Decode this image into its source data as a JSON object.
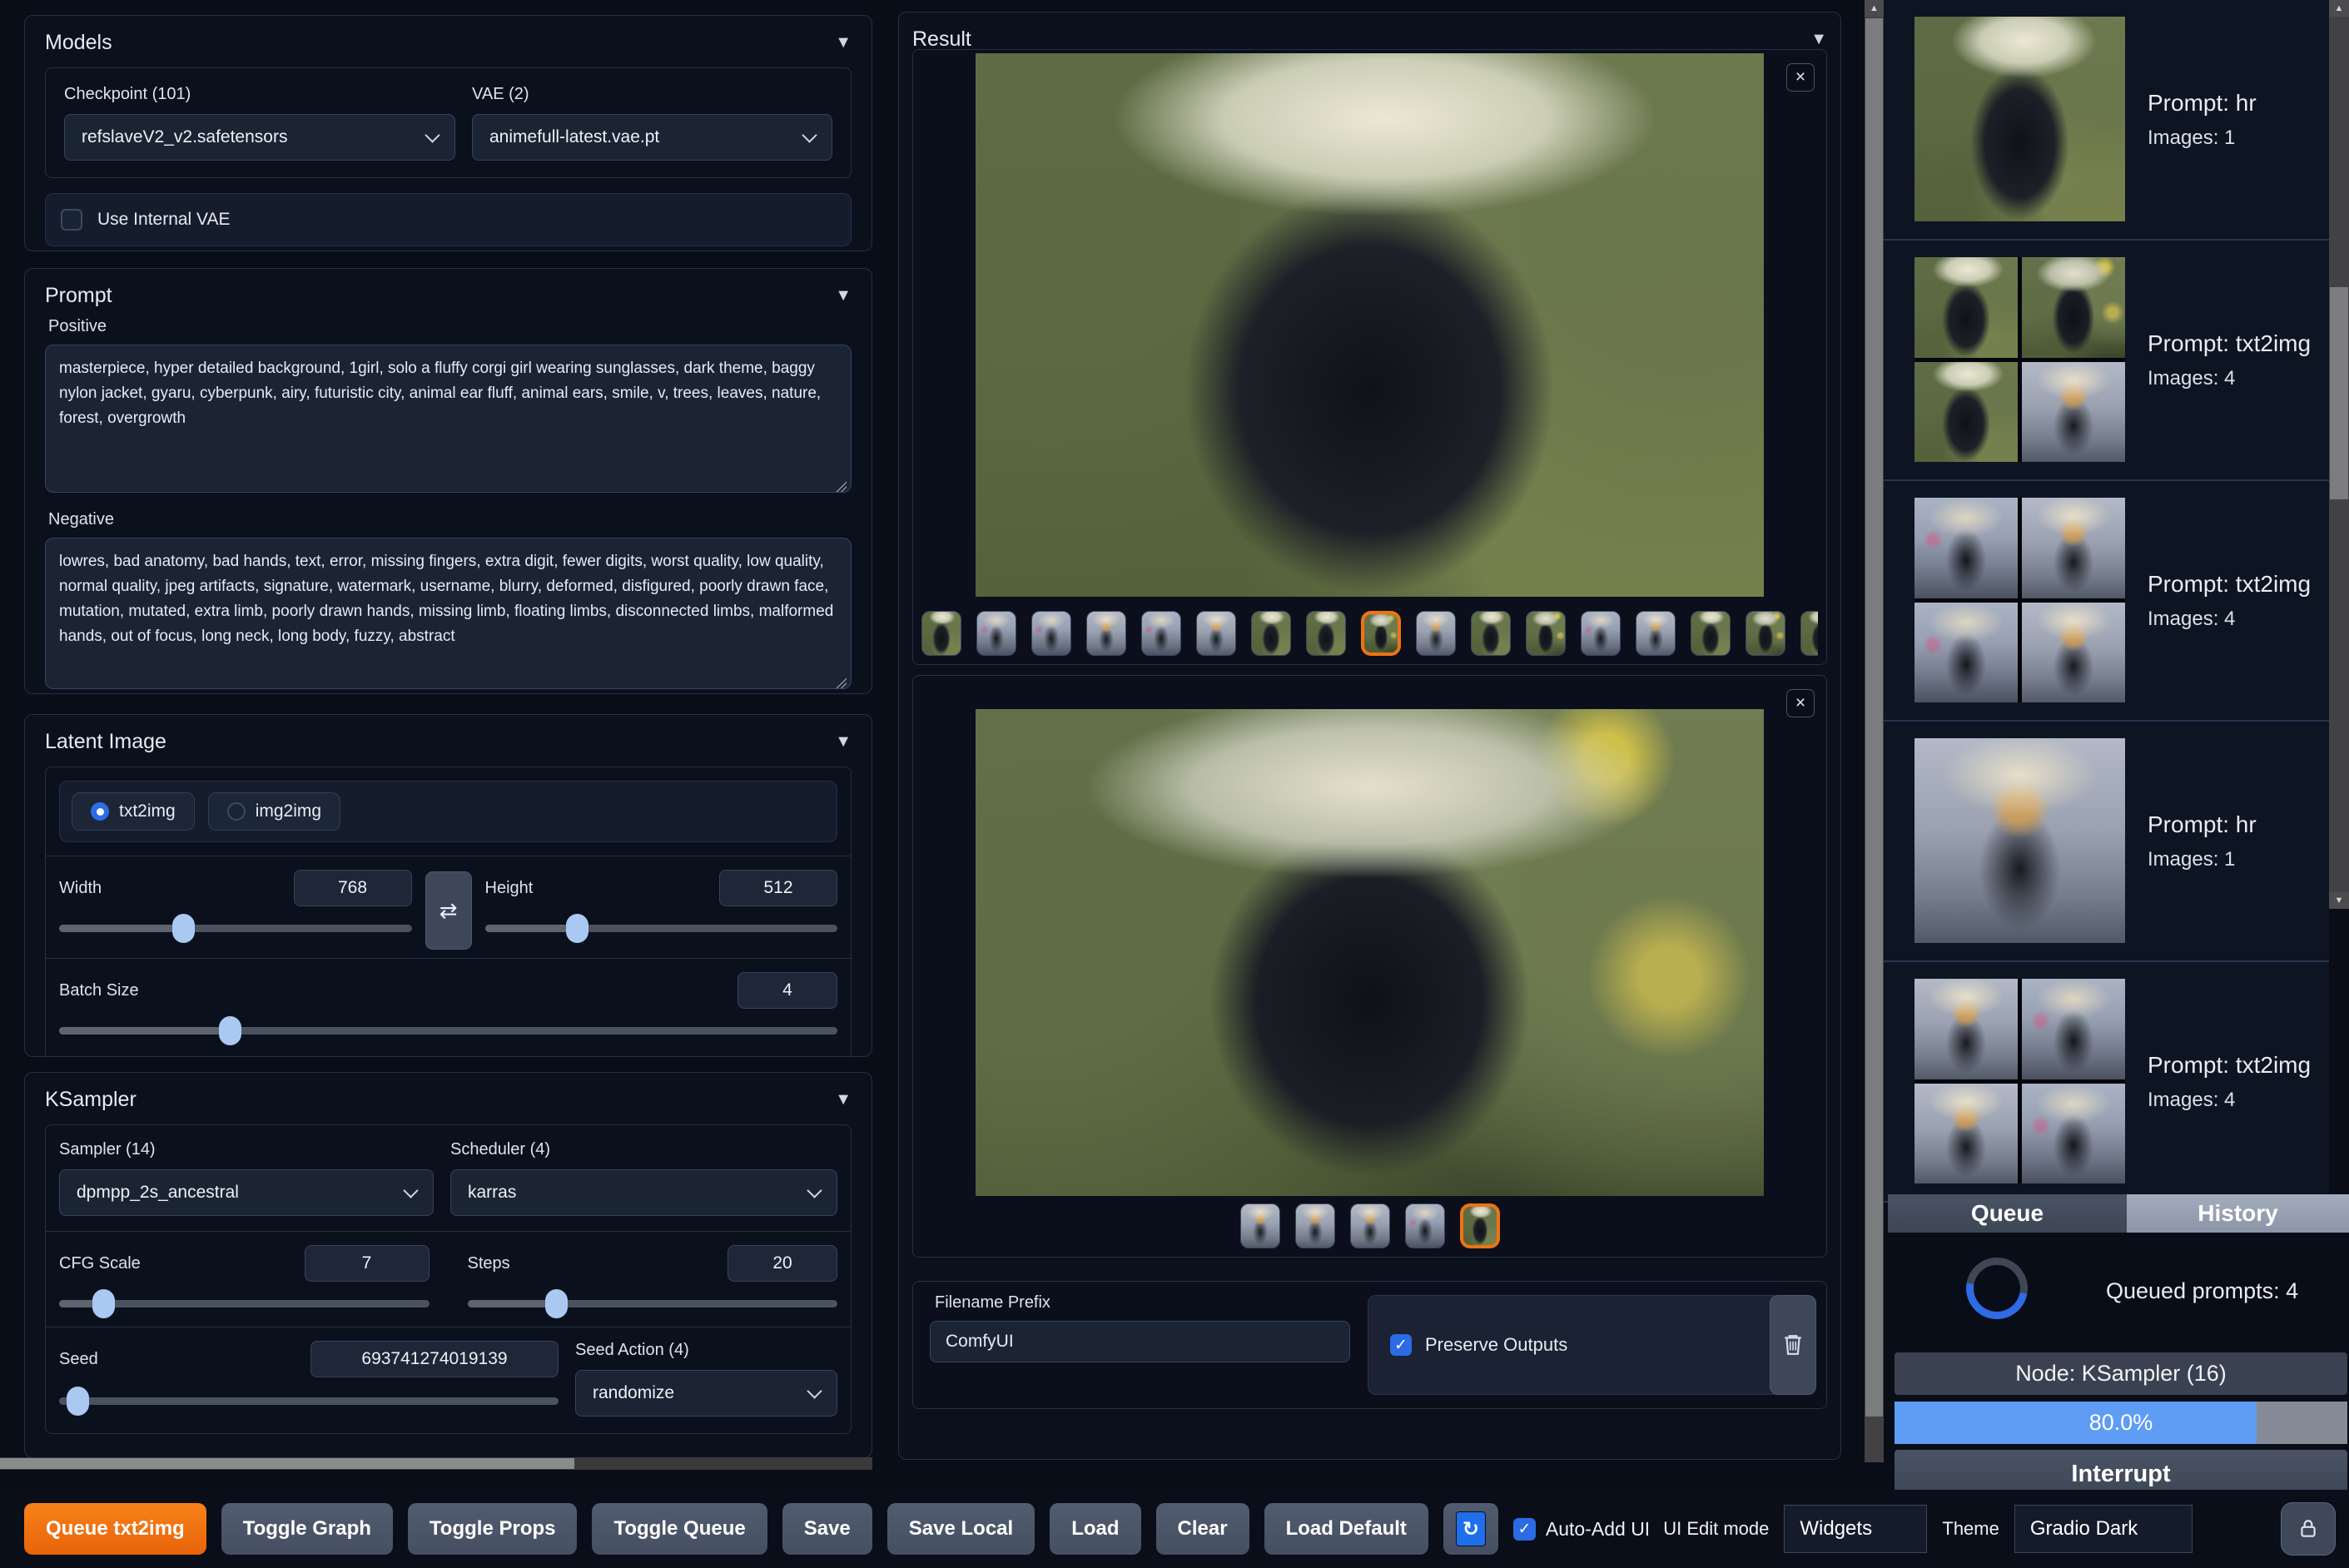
{
  "models": {
    "title": "Models",
    "checkpoint_label": "Checkpoint (101)",
    "checkpoint_value": "refslaveV2_v2.safetensors",
    "vae_label": "VAE (2)",
    "vae_value": "animefull-latest.vae.pt",
    "use_internal_vae_label": "Use Internal VAE",
    "use_internal_vae_checked": false
  },
  "prompt": {
    "title": "Prompt",
    "positive_label": "Positive",
    "positive_value": "masterpiece, hyper detailed background, 1girl, solo a fluffy corgi girl wearing sunglasses, dark theme, baggy nylon jacket, gyaru, cyberpunk, airy, futuristic city, animal ear fluff, animal ears, smile, v, trees, leaves, nature, forest, overgrowth",
    "negative_label": "Negative",
    "negative_value": "lowres, bad anatomy, bad hands, text, error, missing fingers, extra digit, fewer digits, worst quality, low quality, normal quality, jpeg artifacts, signature, watermark, username, blurry, deformed, disfigured, poorly drawn face, mutation, mutated, extra limb, poorly drawn hands, missing limb, floating limbs, disconnected limbs, malformed hands, out of focus, long neck, long body, fuzzy, abstract"
  },
  "latent": {
    "title": "Latent Image",
    "mode_options": [
      "txt2img",
      "img2img"
    ],
    "mode_selected": "txt2img",
    "width_label": "Width",
    "width_value": "768",
    "height_label": "Height",
    "height_value": "512",
    "batch_label": "Batch Size",
    "batch_value": "4"
  },
  "ksampler": {
    "title": "KSampler",
    "sampler_label": "Sampler (14)",
    "sampler_value": "dpmpp_2s_ancestral",
    "scheduler_label": "Scheduler (4)",
    "scheduler_value": "karras",
    "cfg_label": "CFG Scale",
    "cfg_value": "7",
    "steps_label": "Steps",
    "steps_value": "20",
    "seed_label": "Seed",
    "seed_value": "693741274019139",
    "seed_action_label": "Seed Action (4)",
    "seed_action_value": "randomize"
  },
  "result": {
    "title": "Result",
    "gallery1_thumb_count": 17,
    "gallery1_selected_index": 9,
    "gallery2_thumb_count": 5,
    "gallery2_selected_index": 5,
    "filename_prefix_label": "Filename Prefix",
    "filename_prefix_value": "ComfyUI",
    "preserve_outputs_label": "Preserve Outputs",
    "preserve_outputs_checked": true
  },
  "sidebar": {
    "entries": [
      {
        "prompt_label": "Prompt: hr",
        "images_label": "Images: 1",
        "thumbnail_type": "single"
      },
      {
        "prompt_label": "Prompt: txt2img",
        "images_label": "Images: 4",
        "thumbnail_type": "grid4"
      },
      {
        "prompt_label": "Prompt: txt2img",
        "images_label": "Images: 4",
        "thumbnail_type": "grid4"
      },
      {
        "prompt_label": "Prompt: hr",
        "images_label": "Images: 1",
        "thumbnail_type": "single"
      },
      {
        "prompt_label": "Prompt: txt2img",
        "images_label": "Images: 4",
        "thumbnail_type": "grid4"
      }
    ],
    "tabs": {
      "queue": "Queue",
      "history": "History"
    }
  },
  "queue_panel": {
    "queued_prompts_label": "Queued prompts: 4",
    "node_label": "Node: KSampler (16)",
    "progress_label": "80.0%",
    "progress_percent": 80,
    "interrupt_label": "Interrupt"
  },
  "toolbar": {
    "buttons": [
      "Queue txt2img",
      "Toggle Graph",
      "Toggle Props",
      "Toggle Queue",
      "Save",
      "Save Local",
      "Load",
      "Clear",
      "Load Default"
    ],
    "auto_add_label": "Auto-Add UI",
    "auto_add_checked": true,
    "ui_edit_mode_label": "UI Edit mode",
    "widgets_value": "Widgets",
    "theme_label": "Theme",
    "theme_value": "Gradio Dark"
  },
  "icons": {
    "collapse": "▼",
    "swap": "⇄",
    "close": "×",
    "check": "✓",
    "refresh": "↻",
    "scroll_up": "▲",
    "scroll_down": "▼"
  },
  "colors": {
    "accent_orange": "#ee7311",
    "accent_blue": "#2b65dc",
    "progress_blue": "#5f9cf3",
    "background": "#090d17"
  }
}
